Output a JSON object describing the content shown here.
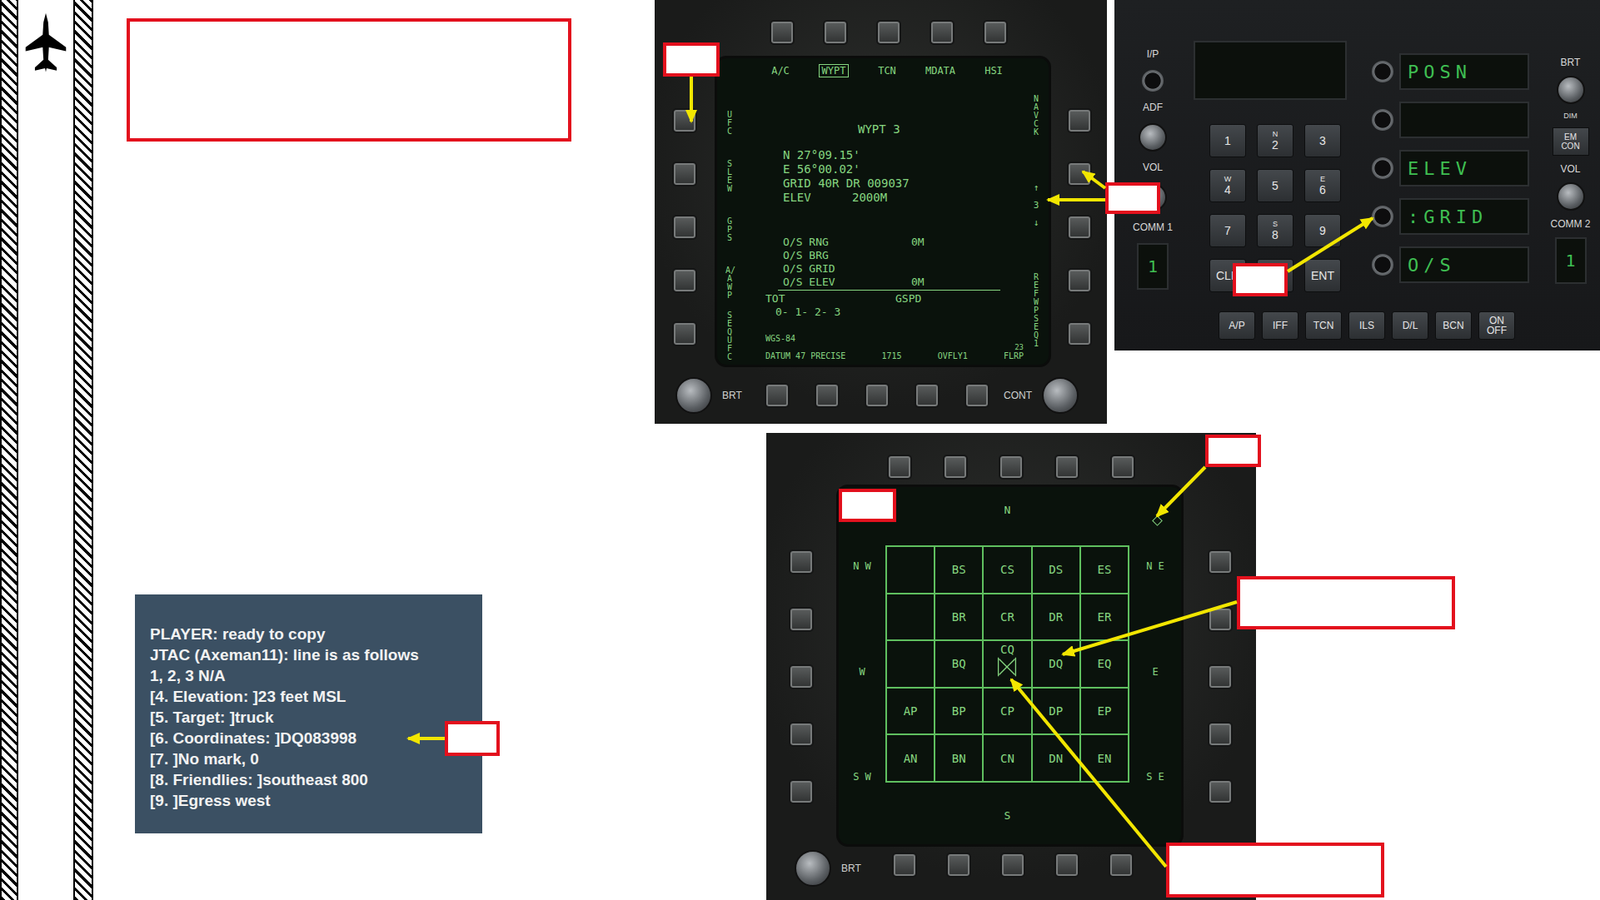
{
  "chat": {
    "lines": [
      "PLAYER: ready to copy",
      "JTAC (Axeman11): line is as follows",
      "1, 2, 3 N/A",
      "[4. Elevation: ]23 feet MSL",
      "[5. Target: ]truck",
      "[6. Coordinates: ]DQ083998",
      "[7. ]No mark, 0",
      "[8. Friendlies: ]southeast 800",
      "[9. ]Egress west"
    ]
  },
  "waypoint_mfd": {
    "top_options": [
      {
        "label": "A/C",
        "selected": false
      },
      {
        "label": "WYPT",
        "selected": true
      },
      {
        "label": "TCN",
        "selected": false
      },
      {
        "label": "MDATA",
        "selected": false
      },
      {
        "label": "HSI",
        "selected": false
      }
    ],
    "left_options": [
      "UFC",
      "SLEW",
      "GPS",
      "A/A WP",
      "SEQUFC"
    ],
    "right_options": {
      "top": "NAV CK",
      "up": "↑",
      "number": "3",
      "down": "↓",
      "bottom": "REF WP SEQ1"
    },
    "title": "WYPT 3",
    "position": [
      "N 27°09.15'",
      "E 56°00.02'",
      "GRID 40R DR 009037"
    ],
    "elevation": {
      "label": "ELEV",
      "value": "2000M"
    },
    "offsets": [
      {
        "label": "O/S RNG",
        "value": "0M"
      },
      {
        "label": "O/S BRG",
        "value": ""
      },
      {
        "label": "O/S GRID",
        "value": ""
      },
      {
        "label": "O/S ELEV",
        "value": "0M"
      }
    ],
    "tot": "TOT",
    "gspd": "GSPD",
    "sequence": "0- 1- 2- 3",
    "datum": "WGS-84",
    "footer": [
      "DATUM 47 PRECISE",
      "1715",
      "OVFLY1"
    ],
    "flrp_count": "23",
    "flrp": "FLRP",
    "brightness": "BRT",
    "contrast": "CONT"
  },
  "ufc": {
    "ip": "I/P",
    "adf": "ADF",
    "vol_left": "VOL",
    "comm_left": "COMM 1",
    "channel_left": "1",
    "keys": [
      {
        "sub": "",
        "main": "1"
      },
      {
        "sub": "N",
        "main": "2"
      },
      {
        "sub": "",
        "main": "3"
      },
      {
        "sub": "W",
        "main": "4"
      },
      {
        "sub": "",
        "main": "5"
      },
      {
        "sub": "E",
        "main": "6"
      },
      {
        "sub": "",
        "main": "7"
      },
      {
        "sub": "S",
        "main": "8"
      },
      {
        "sub": "",
        "main": "9"
      },
      {
        "sub": "",
        "main": "CLR"
      },
      {
        "sub": "",
        "main": ""
      },
      {
        "sub": "",
        "main": "ENT"
      }
    ],
    "options": [
      "POSN",
      "",
      "ELEV",
      ":GRID",
      "O/S"
    ],
    "brt": "BRT",
    "dim": "DIM",
    "emcon": "EM CON",
    "vol_right": "VOL",
    "comm_right": "COMM 2",
    "channel_right": "1",
    "functions": [
      "A/P",
      "IFF",
      "TCN",
      "ILS",
      "D/L",
      "BCN",
      "ON OFF"
    ]
  },
  "grid_mfd": {
    "compass": {
      "n": "N",
      "ne": "N E",
      "e": "E",
      "se": "S E",
      "s": "S",
      "sw": "S W",
      "w": "W",
      "nw": "N W"
    },
    "cells": [
      [
        {
          "label": "",
          "marked": false
        },
        {
          "label": "BS",
          "marked": false
        },
        {
          "label": "CS",
          "marked": false
        },
        {
          "label": "DS",
          "marked": false
        },
        {
          "label": "ES",
          "marked": false
        }
      ],
      [
        {
          "label": "",
          "marked": false
        },
        {
          "label": "BR",
          "marked": false
        },
        {
          "label": "CR",
          "marked": false
        },
        {
          "label": "DR",
          "marked": false
        },
        {
          "label": "ER",
          "marked": false
        }
      ],
      [
        {
          "label": "",
          "marked": false
        },
        {
          "label": "BQ",
          "marked": false
        },
        {
          "label": "CQ",
          "marked": true
        },
        {
          "label": "DQ",
          "marked": false
        },
        {
          "label": "EQ",
          "marked": false
        }
      ],
      [
        {
          "label": "AP",
          "marked": false
        },
        {
          "label": "BP",
          "marked": false
        },
        {
          "label": "CP",
          "marked": false
        },
        {
          "label": "DP",
          "marked": false
        },
        {
          "label": "EP",
          "marked": false
        }
      ],
      [
        {
          "label": "AN",
          "marked": false
        },
        {
          "label": "BN",
          "marked": false
        },
        {
          "label": "CN",
          "marked": false
        },
        {
          "label": "DN",
          "marked": false
        },
        {
          "label": "EN",
          "marked": false
        }
      ]
    ],
    "brightness": "BRT"
  }
}
